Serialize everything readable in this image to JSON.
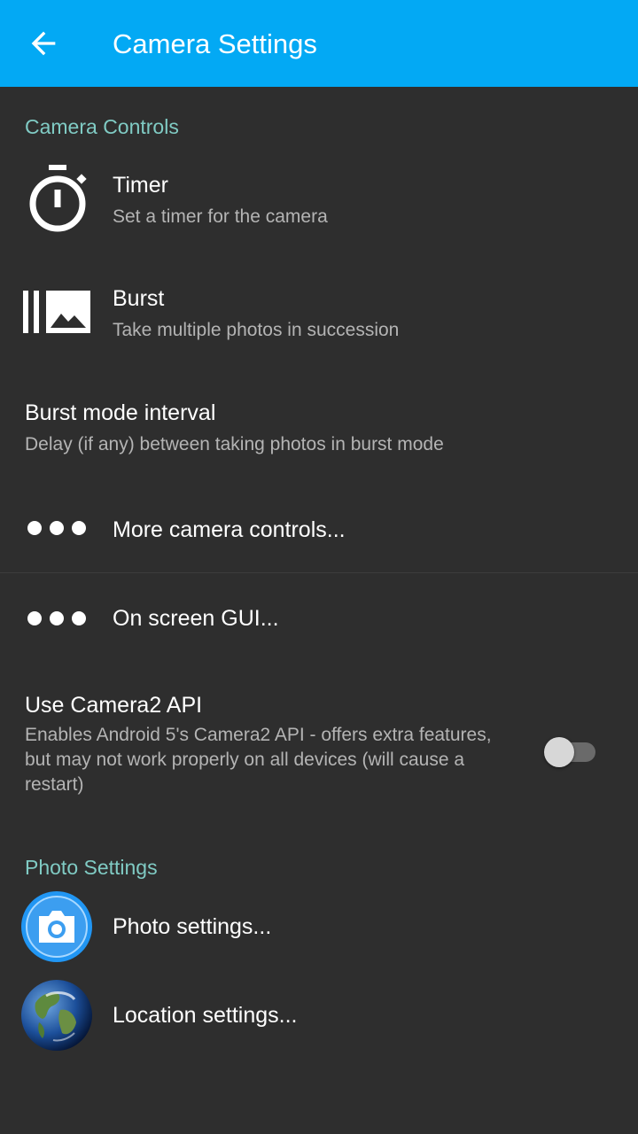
{
  "app_bar": {
    "title": "Camera Settings",
    "back_icon": "arrow-back-icon",
    "color": "#03a9f4"
  },
  "sections": {
    "camera_controls": "Camera Controls",
    "photo_settings": "Photo Settings",
    "header_color": "#80cbc4"
  },
  "prefs": {
    "timer": {
      "title": "Timer",
      "summary": "Set a timer for the camera",
      "icon": "timer-icon"
    },
    "burst": {
      "title": "Burst",
      "summary": "Take multiple photos in succession",
      "icon": "burst-mode-icon"
    },
    "burst_interval": {
      "title": "Burst mode interval",
      "summary": "Delay (if any) between taking photos in burst mode"
    },
    "more_controls": {
      "title": "More camera controls...",
      "icon": "more-horizontal-icon"
    },
    "on_screen_gui": {
      "title": "On screen GUI...",
      "icon": "more-horizontal-icon"
    },
    "camera2_api": {
      "title": "Use Camera2 API",
      "summary": "Enables Android 5's Camera2 API - offers extra features, but may not work properly on all devices (will cause a restart)",
      "enabled": false
    },
    "photo_settings": {
      "title": "Photo settings...",
      "icon": "camera-icon"
    },
    "location_settings": {
      "title": "Location settings...",
      "icon": "globe-icon"
    }
  }
}
